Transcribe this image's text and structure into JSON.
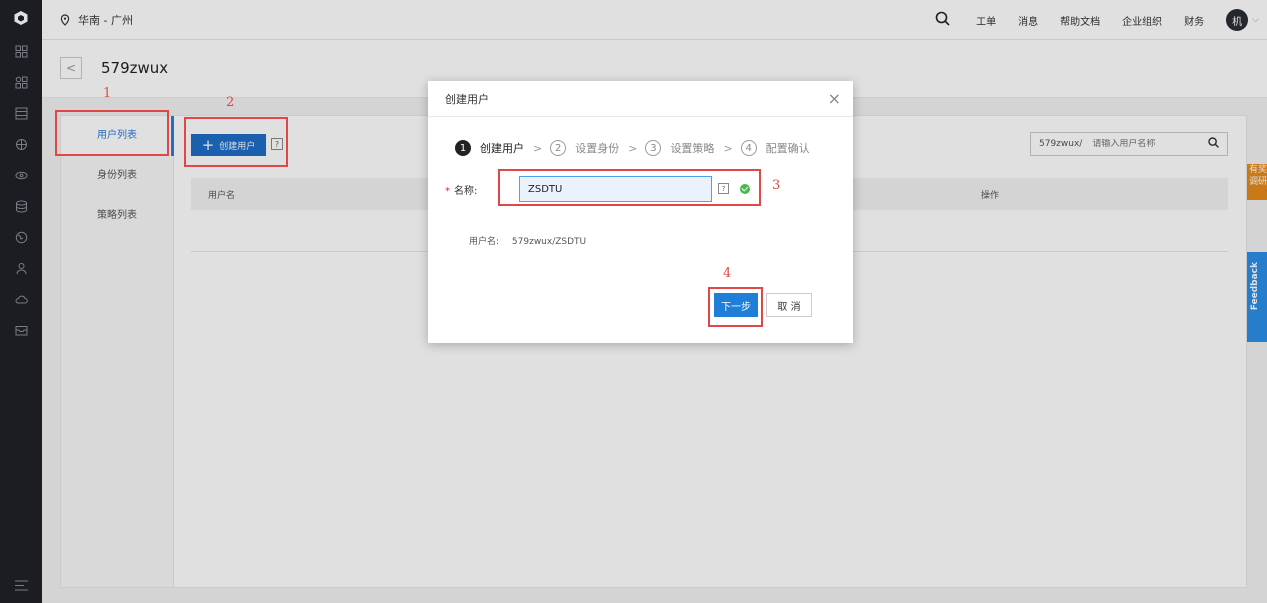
{
  "rail": {
    "icons": [
      "grid-icon",
      "apps-icon",
      "server-icon",
      "network-icon",
      "eye-icon",
      "database-icon",
      "globe-icon",
      "users-icon",
      "cloud-icon",
      "mail-icon"
    ],
    "bottom_icon": "menu-icon"
  },
  "topbar": {
    "region": "华南 - 广州",
    "nav": [
      "工单",
      "消息",
      "帮助文档",
      "企业组织",
      "财务"
    ],
    "avatar": "机"
  },
  "title": {
    "back": "<",
    "page_title": "579zwux"
  },
  "subnav": [
    "用户列表",
    "身份列表",
    "策略列表"
  ],
  "toolbar": {
    "create_label": "创建用户",
    "help": "?"
  },
  "filter": {
    "prefix": "579zwux/",
    "placeholder": "请输入用户名称"
  },
  "table": {
    "col_username": "用户名",
    "col_actions": "操作"
  },
  "modal": {
    "title": "创建用户",
    "close": "×",
    "steps": [
      {
        "num": "1",
        "label": "创建用户"
      },
      {
        "num": "2",
        "label": "设置身份"
      },
      {
        "num": "3",
        "label": "设置策略"
      },
      {
        "num": "4",
        "label": "配置确认"
      }
    ],
    "name_required": "*",
    "name_label": "名称:",
    "name_value": "ZSDTU",
    "name_help": "?",
    "username_label": "用户名:",
    "username_value": "579zwux/ZSDTU",
    "next_label": "下一步",
    "cancel_label": "取 消"
  },
  "annotations": [
    "1",
    "2",
    "3",
    "4"
  ],
  "side": {
    "tag": "有奖调研",
    "feedback": "Feedback"
  },
  "colors": {
    "accent": "#1e6ec8",
    "annotation": "#e04848",
    "rail": "#1f2228"
  }
}
